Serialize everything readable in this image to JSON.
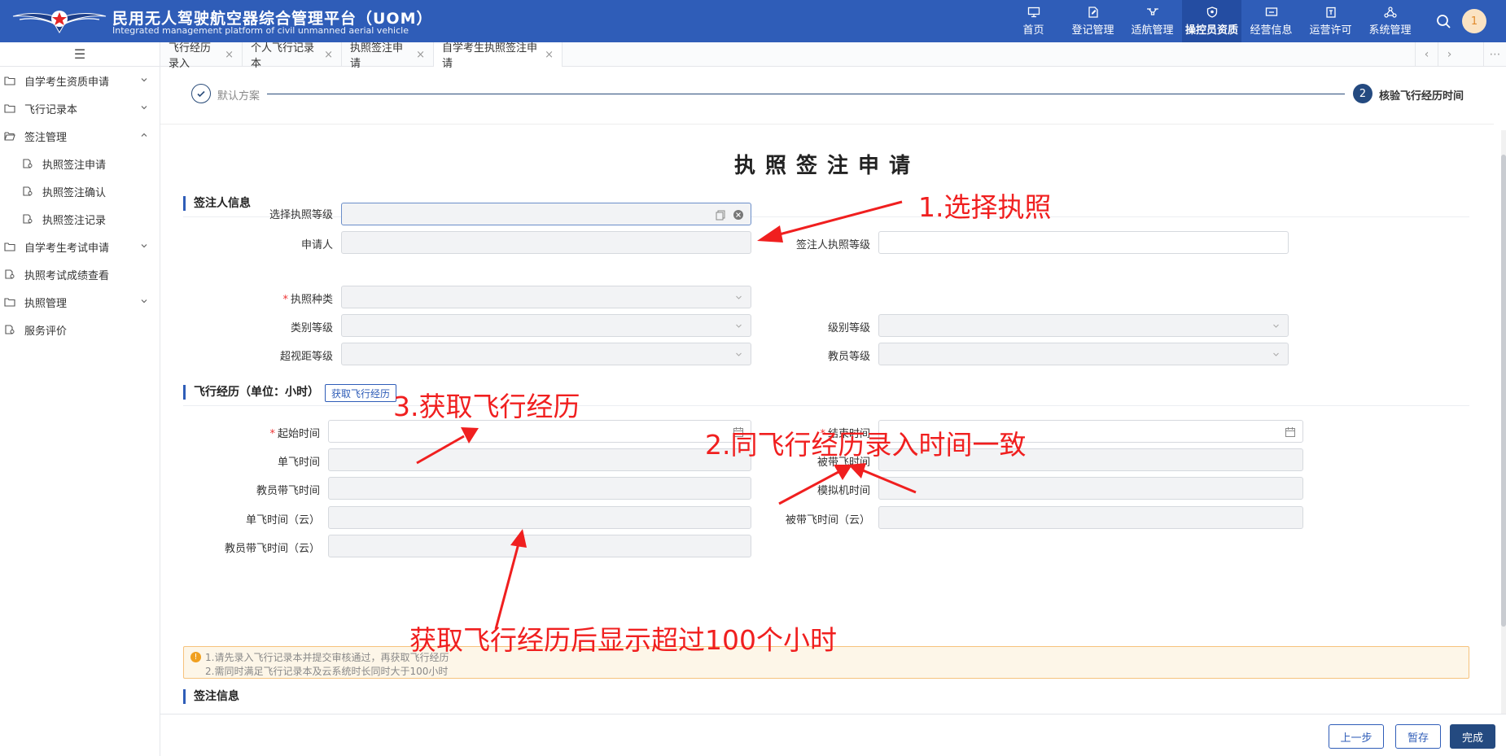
{
  "header": {
    "title": "民用无人驾驶航空器综合管理平台（UOM）",
    "subtitle": "Integrated management platform of civil unmanned aerial vehicle",
    "nav": [
      {
        "label": "首页",
        "icon": "monitor-icon"
      },
      {
        "label": "登记管理",
        "icon": "document-edit-icon"
      },
      {
        "label": "适航管理",
        "icon": "drone-icon"
      },
      {
        "label": "操控员资质",
        "icon": "shield-icon",
        "active": true
      },
      {
        "label": "经营信息",
        "icon": "screen-icon"
      },
      {
        "label": "运营许可",
        "icon": "clipboard-icon"
      },
      {
        "label": "系统管理",
        "icon": "network-icon"
      }
    ],
    "avatar": "1"
  },
  "sidebar": {
    "toggle_icon": "hamburger-icon",
    "items": [
      {
        "label": "自学考生资质申请"
      },
      {
        "label": "飞行记录本"
      },
      {
        "label": "签注管理"
      },
      {
        "label": "执照签注申请"
      },
      {
        "label": "执照签注确认"
      },
      {
        "label": "执照签注记录"
      },
      {
        "label": "自学考生考试申请"
      },
      {
        "label": "执照考试成绩查看"
      },
      {
        "label": "执照管理"
      },
      {
        "label": "服务评价"
      }
    ]
  },
  "tabs": [
    {
      "label": "飞行经历录入",
      "close": "×"
    },
    {
      "label": "个人飞行记录本",
      "close": "×"
    },
    {
      "label": "执照签注申请",
      "close": "×"
    },
    {
      "label": "自学考生执照签注申请",
      "close": "×"
    }
  ],
  "steps": {
    "step1_label": "默认方案",
    "step2_num": "2",
    "step2_label": "核验飞行经历时间"
  },
  "form": {
    "title": "执照签注申请",
    "section1": "签注人信息",
    "fields": {
      "license_level": "选择执照等级",
      "applicant": "申请人",
      "endorser_level": "签注人执照等级",
      "license_type": "执照种类",
      "category_level": "类别等级",
      "grade_level": "级别等级",
      "bvlos_level": "超视距等级",
      "instructor_level": "教员等级"
    },
    "section2": "飞行经历（单位：小时）",
    "fetch_button": "获取飞行经历",
    "flight_fields": {
      "start_time": "起始时间",
      "end_time": "结束时间",
      "solo_time": "单飞时间",
      "dual_time": "被带飞时间",
      "instructor_time": "教员带飞时间",
      "sim_time": "模拟机时间",
      "solo_cloud": "单飞时间（云）",
      "dual_cloud": "被带飞时间（云）",
      "instructor_cloud": "教员带飞时间（云）"
    },
    "warning": {
      "line1": "1.请先录入飞行记录本并提交审核通过，再获取飞行经历",
      "line2": "2.需同时满足飞行记录本及云系统时长同时大于100小时"
    },
    "section3": "签注信息"
  },
  "footer": {
    "prev": "上一步",
    "save": "暂存",
    "finish": "完成"
  },
  "annotations": {
    "a1": "1.选择执照",
    "a2": "2.同飞行经历录入时间一致",
    "a3": "3.获取飞行经历",
    "a4": "获取飞行经历后显示超过100个小时"
  },
  "colors": {
    "header_bg": "#2f5db8",
    "annotation": "#f01f1f",
    "primary": "#244a80"
  }
}
